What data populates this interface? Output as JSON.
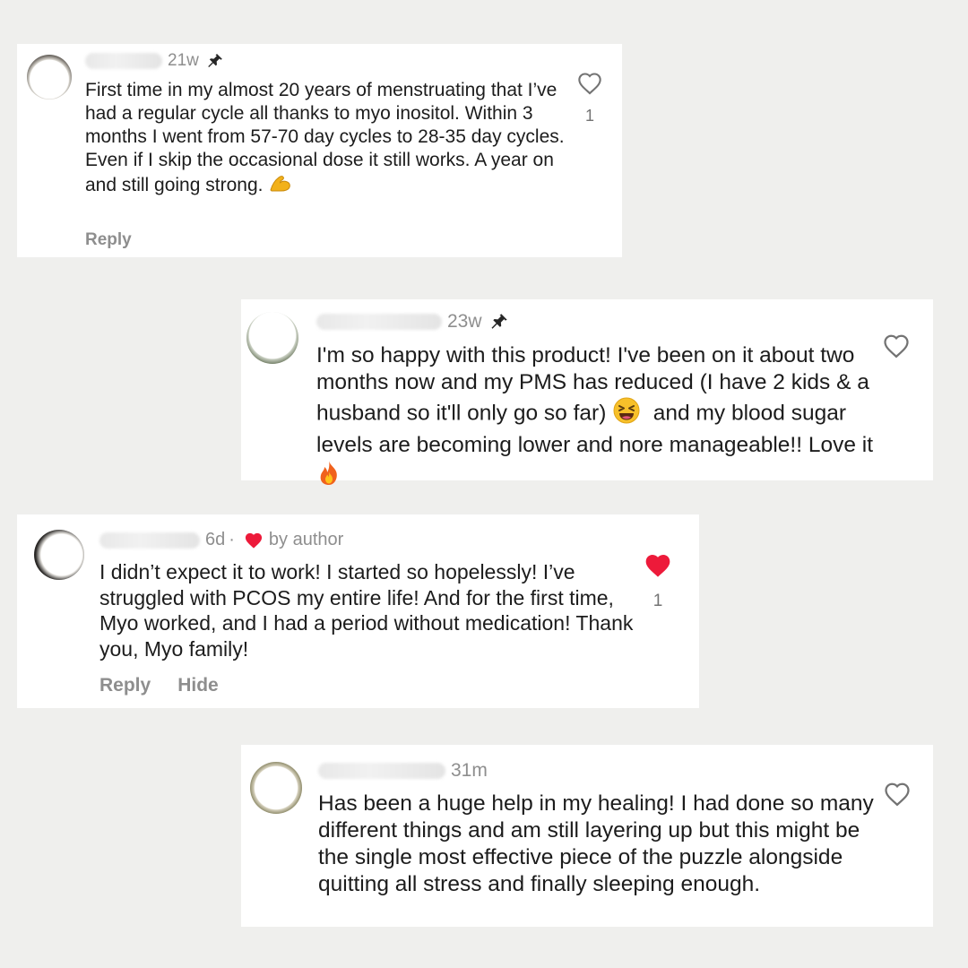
{
  "colors": {
    "background": "#efefed",
    "card": "#ffffff",
    "text": "#1c1c1c",
    "muted": "#8e8e8e",
    "like_red": "#ed1a3a"
  },
  "comments": [
    {
      "username": "t_ e_ _ _",
      "time": "21w",
      "pinned": true,
      "text": "First time in my almost 20 years of menstruating that I’ve had a regular cycle all thanks to myo inositol. Within 3 months I went from 57-70 day cycles to 28-35 day cycles. Even if I skip the occasional dose it still works. A year on and still going strong.",
      "emoji_icon": "flexed-biceps-icon",
      "actions": [
        "Reply"
      ],
      "liked": false,
      "like_count": "1"
    },
    {
      "username": "atenhh_ _ 02",
      "time": "23w",
      "pinned": true,
      "text_a": "I'm so happy with this product! I've been on it about two months now and my PMS has reduced (I have 2 kids & a husband so it'll only go so far)",
      "emoji_icon_a": "grinning-squinting-face-icon",
      "text_b": "and my blood sugar levels are becoming lower and nore manageable!! Love it",
      "emoji_icon_b": "fire-icon",
      "liked": false
    },
    {
      "username": "c_ l_ _ _",
      "time": "6d",
      "separator": "·",
      "liked_by_author": "by author",
      "text": "I didn’t expect it to work! I started so hopelessly! I’ve struggled with PCOS my entire life! And for the first time, Myo worked, and I had a period without medication! Thank you, Myo family!",
      "actions": [
        "Reply",
        "Hide"
      ],
      "liked": true,
      "like_count": "1"
    },
    {
      "username": "jacintap_ _ _ si",
      "time": "31m",
      "text": "Has been a huge help in my healing! I had done so many different things and am still layering up but this might be the single most effective piece of the puzzle alongside quitting all stress and finally sleeping enough.",
      "liked": false
    }
  ]
}
